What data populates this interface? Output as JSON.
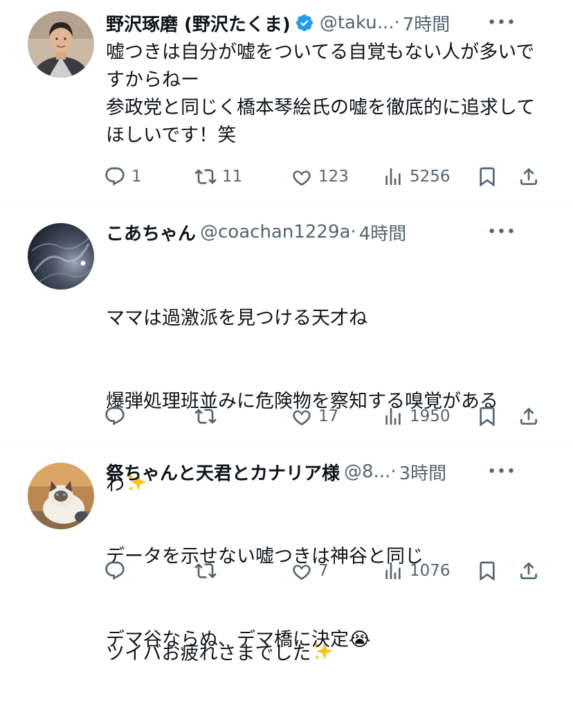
{
  "tweets": [
    {
      "name": "野沢琢磨 (野沢たくま)",
      "handle": "@taku...",
      "dot": "·",
      "time": "7時間",
      "more": "•••",
      "body": "嘘つきは自分が嘘をついてる自覚もない人が多いですからねー\n参政党と同じく橋本琴絵氏の嘘を徹底的に追求してほしいです！笑",
      "replies": "1",
      "retweets": "11",
      "likes": "123",
      "views": "5256",
      "verified": true
    },
    {
      "name": "こあちゃん",
      "handle": "@coachan1229a",
      "dot": "·",
      "time": "4時間",
      "more": "•••",
      "body_line1": "ママは過激派を見つける天才ね",
      "body_line2": "爆弾処理班並みに危険物を察知する嗅覚がある",
      "body_line3": "わ",
      "body_line4": "ツイバお疲れさまでした",
      "replies": "",
      "retweets": "",
      "likes": "17",
      "views": "1950"
    },
    {
      "name": "祭ちゃんと天君とカナリア様",
      "handle": "@8...",
      "dot": "·",
      "time": "3時間",
      "more": "•••",
      "body_line1": "データを示せない嘘つきは神谷と同じ",
      "body_line2": "デマ谷ならぬ、デマ橋に決定",
      "emoji": "😭",
      "replies": "",
      "retweets": "",
      "likes": "7",
      "views": "1076"
    }
  ],
  "colors": {
    "text": "#0f1419",
    "muted": "#536471",
    "verified": "#1d9bf0",
    "divider": "#eff3f4"
  },
  "icons": [
    "reply-icon",
    "retweet-icon",
    "like-icon",
    "views-icon",
    "bookmark-icon",
    "share-icon",
    "verified-icon",
    "sparkles-icon",
    "crying-emoji"
  ]
}
